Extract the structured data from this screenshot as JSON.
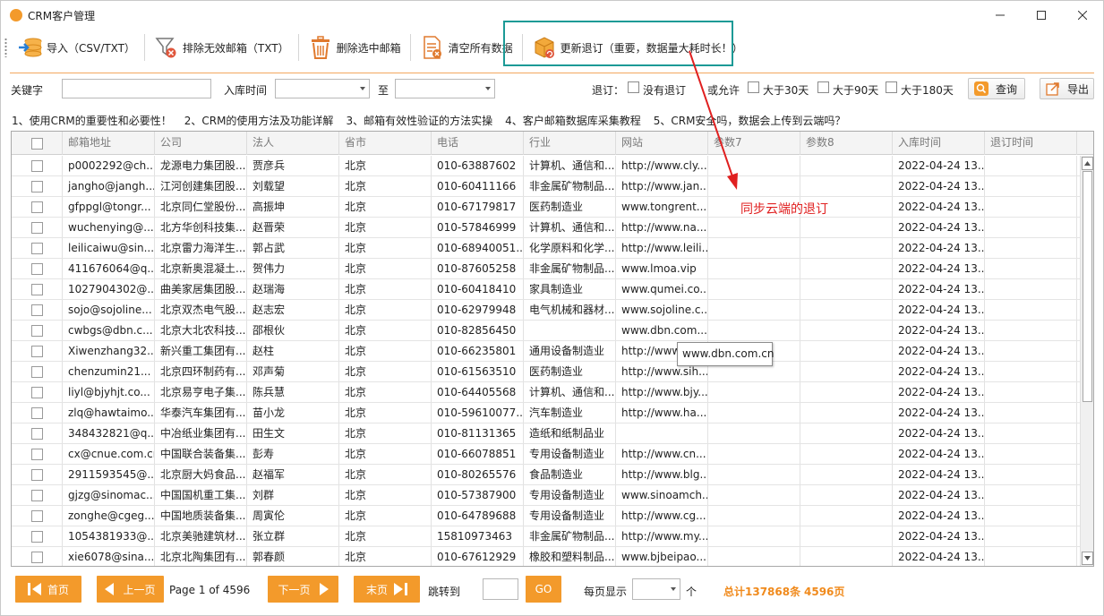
{
  "window": {
    "title": "CRM客户管理",
    "logo_text": "CRM"
  },
  "toolbar": {
    "import_label": "导入（CSV/TXT）",
    "exclude_invalid_label": "排除无效邮箱（TXT）",
    "delete_selected_label": "删除选中邮箱",
    "clear_all_label": "清空所有数据",
    "update_unsub_label": "更新退订（重要，数据量大耗时长！）"
  },
  "search": {
    "keyword_label": "关键字",
    "keyword_value": "",
    "date_label": "入库时间",
    "date_from": "",
    "date_to_label": "至",
    "date_to": "",
    "unsub_label": "退订：",
    "opt_none": "没有退订",
    "or_allow": "或允许",
    "opt_30": "大于30天",
    "opt_90": "大于90天",
    "opt_180": "大于180天",
    "query_label": "查询",
    "export_label": "导出"
  },
  "links": [
    "1、使用CRM的重要性和必要性！",
    "2、CRM的使用方法及功能详解",
    "3、邮箱有效性验证的方法实操",
    "4、客户邮箱数据库采集教程",
    "5、CRM安全吗，数据会上传到云端吗？"
  ],
  "table": {
    "columns": [
      "邮箱地址",
      "公司",
      "法人",
      "省市",
      "电话",
      "行业",
      "网站",
      "参数7",
      "参数8",
      "入库时间",
      "退订时间"
    ],
    "rows": [
      [
        "p0002292@ch...",
        "龙源电力集团股...",
        "贾彦兵",
        "北京",
        "010-63887602",
        "计算机、通信和...",
        "http://www.cly...",
        "",
        "",
        "2022-04-24 13...",
        ""
      ],
      [
        "jangho@jangh...",
        "江河创建集团股...",
        "刘载望",
        "北京",
        "010-60411166",
        "非金属矿物制品...",
        "http://www.jan...",
        "",
        "",
        "2022-04-24 13...",
        ""
      ],
      [
        "gfppgl@tongr...",
        "北京同仁堂股份...",
        "高振坤",
        "北京",
        "010-67179817",
        "医药制造业",
        "www.tongrent...",
        "",
        "",
        "2022-04-24 13...",
        ""
      ],
      [
        "wuchenying@...",
        "北方华创科技集...",
        "赵晋荣",
        "北京",
        "010-57846999",
        "计算机、通信和...",
        "http://www.na...",
        "",
        "",
        "2022-04-24 13...",
        ""
      ],
      [
        "leilicaiwu@sin...",
        "北京雷力海洋生...",
        "郭占武",
        "北京",
        "010-68940051...",
        "化学原料和化学...",
        "http://www.leili...",
        "",
        "",
        "2022-04-24 13...",
        ""
      ],
      [
        "411676064@q...",
        "北京新奥混凝土...",
        "贺伟力",
        "北京",
        "010-87605258",
        "非金属矿物制品...",
        "www.lmoa.vip",
        "",
        "",
        "2022-04-24 13...",
        ""
      ],
      [
        "1027904302@...",
        "曲美家居集团股...",
        "赵瑞海",
        "北京",
        "010-60418410",
        "家具制造业",
        "www.qumei.co...",
        "",
        "",
        "2022-04-24 13...",
        ""
      ],
      [
        "sojo@sojoline...",
        "北京双杰电气股...",
        "赵志宏",
        "北京",
        "010-62979948",
        "电气机械和器材...",
        "www.sojoline.c...",
        "",
        "",
        "2022-04-24 13...",
        ""
      ],
      [
        "cwbgs@dbn.c...",
        "北京大北农科技...",
        "邵根伙",
        "北京",
        "010-82856450",
        "",
        "www.dbn.com....",
        "",
        "",
        "2022-04-24 13...",
        ""
      ],
      [
        "Xiwenzhang32...",
        "新兴重工集团有...",
        "赵柱",
        "北京",
        "010-66235801",
        "通用设备制造业",
        "http://www...",
        "",
        "",
        "2022-04-24 13...",
        ""
      ],
      [
        "chenzumin21...",
        "北京四环制药有...",
        "邓声菊",
        "北京",
        "010-61563510",
        "医药制造业",
        "http://www.sih...",
        "",
        "",
        "2022-04-24 13...",
        ""
      ],
      [
        "liyl@bjyhjt.co...",
        "北京易亨电子集...",
        "陈兵慧",
        "北京",
        "010-64405568",
        "计算机、通信和...",
        "http://www.bjy...",
        "",
        "",
        "2022-04-24 13...",
        ""
      ],
      [
        "zlq@hawtaimo...",
        "华泰汽车集团有...",
        "苗小龙",
        "北京",
        "010-59610077...",
        "汽车制造业",
        "http://www.ha...",
        "",
        "",
        "2022-04-24 13...",
        ""
      ],
      [
        "348432821@q...",
        "中冶纸业集团有...",
        "田生文",
        "北京",
        "010-81131365",
        "造纸和纸制品业",
        "",
        "",
        "",
        "2022-04-24 13...",
        ""
      ],
      [
        "cx@cnue.com.cn",
        "中国联合装备集...",
        "彭寿",
        "北京",
        "010-66078851",
        "专用设备制造业",
        "http://www.cn...",
        "",
        "",
        "2022-04-24 13...",
        ""
      ],
      [
        "2911593545@...",
        "北京厨大妈食品...",
        "赵福军",
        "北京",
        "010-80265576",
        "食品制造业",
        "http://www.blg...",
        "",
        "",
        "2022-04-24 13...",
        ""
      ],
      [
        "gjzg@sinomac...",
        "中国国机重工集...",
        "刘群",
        "北京",
        "010-57387900",
        "专用设备制造业",
        "www.sinoamch...",
        "",
        "",
        "2022-04-24 13...",
        ""
      ],
      [
        "zonghe@cgeg...",
        "中国地质装备集...",
        "周寅伦",
        "北京",
        "010-64789688",
        "专用设备制造业",
        "http://www.cg...",
        "",
        "",
        "2022-04-24 13...",
        ""
      ],
      [
        "1054381933@...",
        "北京美驰建筑材...",
        "张立群",
        "北京",
        "15810973463",
        "非金属矿物制品...",
        "http://www.my...",
        "",
        "",
        "2022-04-24 13...",
        ""
      ],
      [
        "xie6078@sina....",
        "北京北陶集团有...",
        "郭春颜",
        "北京",
        "010-67612929",
        "橡胶和塑料制品...",
        "www.bjbeipao....",
        "",
        "",
        "2022-04-24 13...",
        ""
      ]
    ]
  },
  "tooltip": "www.dbn.com.cn",
  "annotation": "同步云端的退订",
  "footer": {
    "first": "首页",
    "prev": "上一页",
    "page_info": "Page 1 of 4596",
    "next": "下一页",
    "last": "末页",
    "jump_label": "跳转到",
    "jump_value": "",
    "go": "GO",
    "per_page_label": "每页显示",
    "per_page_value": "",
    "per_page_unit": "个",
    "total": "总计137868条",
    "pages": "4596页"
  },
  "colors": {
    "accent": "#f39a2b",
    "callout": "#1c9a96",
    "annotation": "#e02020"
  }
}
